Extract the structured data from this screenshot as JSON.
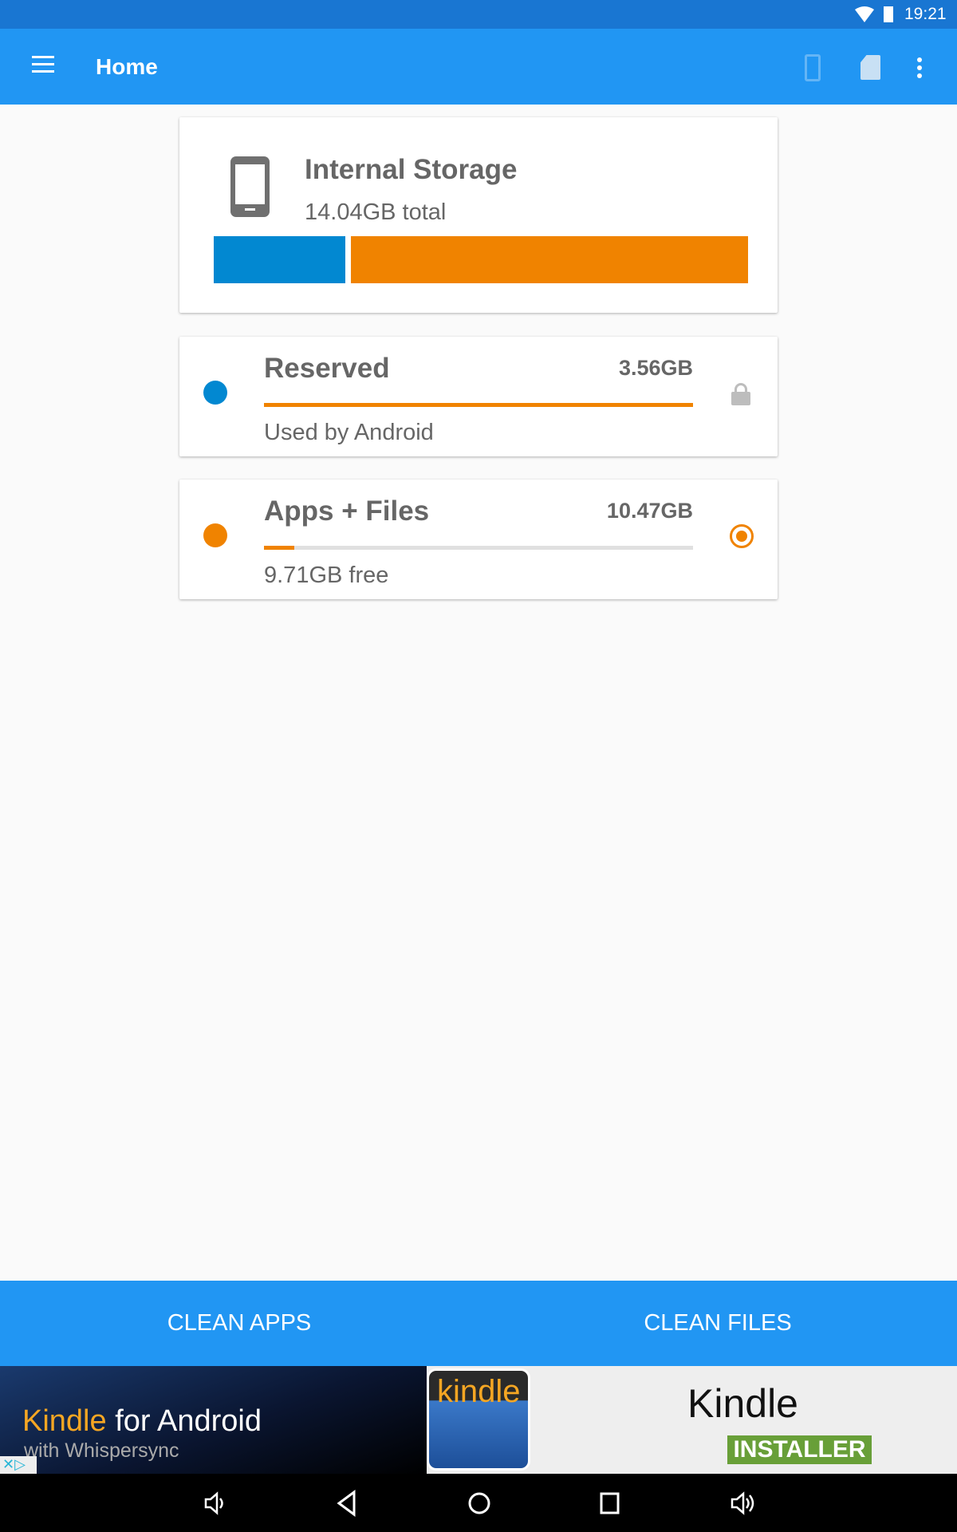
{
  "status_bar": {
    "time": "19:21",
    "icons": [
      "wifi-icon",
      "battery-icon"
    ]
  },
  "toolbar": {
    "title": "Home",
    "icons": [
      "menu-icon",
      "phone-icon",
      "sd-card-icon",
      "more-vert-icon"
    ]
  },
  "storage": {
    "title": "Internal Storage",
    "total": "14.04GB total",
    "segments": [
      {
        "name": "Reserved",
        "value_gb": 3.56,
        "color": "#0288d1"
      },
      {
        "name": "Apps + Files",
        "value_gb": 10.47,
        "color": "#f08300"
      }
    ]
  },
  "reserved": {
    "title": "Reserved",
    "size": "3.56GB",
    "subtitle": "Used by Android",
    "progress_percent": 100,
    "dot_color": "#0288d1",
    "icon": "lock-icon"
  },
  "apps_files": {
    "title": "Apps + Files",
    "size": "10.47GB",
    "subtitle": "9.71GB free",
    "progress_percent": 7,
    "dot_color": "#f08300",
    "icon": "radio-selected-icon"
  },
  "bottom": {
    "clean_apps": "CLEAN APPS",
    "clean_files": "CLEAN FILES"
  },
  "ad": {
    "headline_brand": "Kindle",
    "headline_rest": " for Android",
    "tagline": "with Whispersync",
    "logo_text": "kindle",
    "app_name": "Kindle",
    "cta": "INSTALLER"
  },
  "nav": {
    "icons": [
      "volume-down-icon",
      "back-icon",
      "home-icon",
      "recents-icon",
      "volume-up-icon"
    ]
  }
}
